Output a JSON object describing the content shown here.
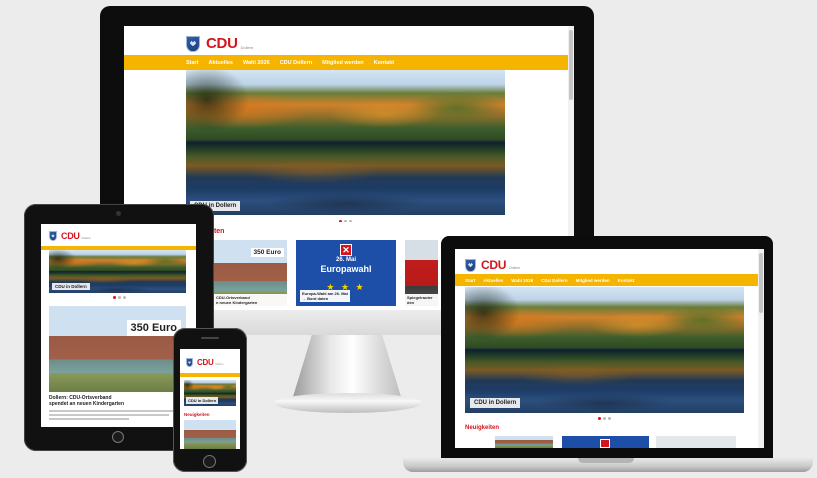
{
  "site": {
    "logo_text": "CDU",
    "logo_sub": "Dollern",
    "nav": [
      "Start",
      "Aktuelles",
      "Wahl 2026",
      "CDU Dollern",
      "Mitglied werden",
      "Kontakt"
    ],
    "hero_caption": "CDU in Dollern",
    "section_title": "Neuigkeiten",
    "section_title_partial": "iten",
    "colors": {
      "brand_red": "#d6141c",
      "nav_yellow": "#f4b400",
      "eu_blue": "#1d4ea8"
    }
  },
  "cards": {
    "kindergarten": {
      "price_tag": "350 Euro",
      "label_partial": "CDU-Ortsverband",
      "label_line2": "n neuen Kindergarten"
    },
    "europa": {
      "tag_date": "26. Mai",
      "tag_title": "Europawahl",
      "label": "Europa-Wahl am 26. Mai",
      "label_line2": "→ Bord daten"
    },
    "fire": {
      "label": "Spiegelrauter",
      "label_line2": "den"
    }
  },
  "tablet_article": {
    "price_tag": "350 Euro",
    "title_line1": "Dollern: CDU-Ortsverband",
    "title_line2": "spendet an neuen Kindergarten"
  },
  "icons": {
    "crest": "cdu-crest-icon",
    "eu_cross": "ballot-cross-icon"
  }
}
